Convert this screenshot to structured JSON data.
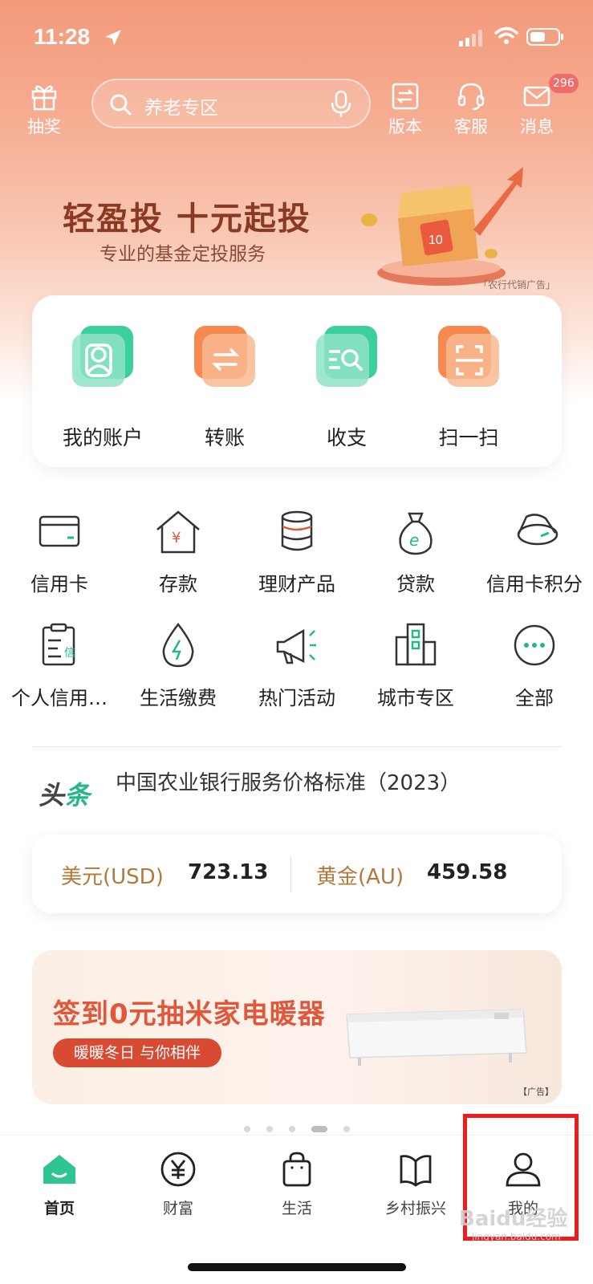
{
  "status_bar": {
    "time": "11:28"
  },
  "top_bar": {
    "left_button": {
      "label": "抽奖",
      "icon": "gift-icon"
    },
    "search": {
      "placeholder": "养老专区",
      "icon": "search-icon",
      "voice_icon": "microphone-icon"
    },
    "right_buttons": [
      {
        "label": "版本",
        "icon": "version-switch-icon"
      },
      {
        "label": "客服",
        "icon": "headset-icon"
      },
      {
        "label": "消息",
        "icon": "mail-icon",
        "badge": "296"
      }
    ]
  },
  "banner": {
    "title": "轻盈投  十元起投",
    "subtitle": "专业的基金定投服务",
    "ad_tag": "「农行代销广告」"
  },
  "quick_actions": [
    {
      "label": "我的账户",
      "icon": "account-icon",
      "color": "#3ccf9e"
    },
    {
      "label": "转账",
      "icon": "transfer-icon",
      "color": "#f5894f"
    },
    {
      "label": "收支",
      "icon": "income-expense-icon",
      "color": "#3ccf9e"
    },
    {
      "label": "扫一扫",
      "icon": "scan-icon",
      "color": "#f5894f"
    }
  ],
  "services": [
    {
      "label": "信用卡",
      "icon": "credit-card-icon"
    },
    {
      "label": "存款",
      "icon": "deposit-house-icon"
    },
    {
      "label": "理财产品",
      "icon": "coin-stack-icon"
    },
    {
      "label": "贷款",
      "icon": "money-bag-icon"
    },
    {
      "label": "信用卡积分",
      "icon": "points-icon"
    },
    {
      "label": "个人信用…",
      "icon": "credit-report-icon"
    },
    {
      "label": "生活缴费",
      "icon": "water-drop-icon"
    },
    {
      "label": "热门活动",
      "icon": "megaphone-icon"
    },
    {
      "label": "城市专区",
      "icon": "city-buildings-icon"
    },
    {
      "label": "全部",
      "icon": "more-dots-icon"
    }
  ],
  "headline": {
    "logo_main": "头",
    "logo_accent": "条",
    "text": "中国农业银行服务价格标准（2023）"
  },
  "fx": [
    {
      "name": "美元(USD)",
      "value": "723.13"
    },
    {
      "name": "黄金(AU)",
      "value": "459.58"
    }
  ],
  "promo": {
    "title": "签到0元抽米家电暖器",
    "pill": "暖暖冬日 与你相伴",
    "ad_tag": "【广告】"
  },
  "tabs": [
    {
      "label": "首页",
      "icon": "home-icon",
      "active": true
    },
    {
      "label": "财富",
      "icon": "yen-coin-icon"
    },
    {
      "label": "生活",
      "icon": "shopping-bag-icon"
    },
    {
      "label": "乡村振兴",
      "icon": "book-icon"
    },
    {
      "label": "我的",
      "icon": "user-icon"
    }
  ],
  "watermark": {
    "main": "Baidu经验",
    "sub": "jingyan.baidu.com"
  },
  "colors": {
    "brand_green": "#23b789",
    "accent_orange": "#f5894f",
    "highlight_red": "#ee1c1c"
  }
}
